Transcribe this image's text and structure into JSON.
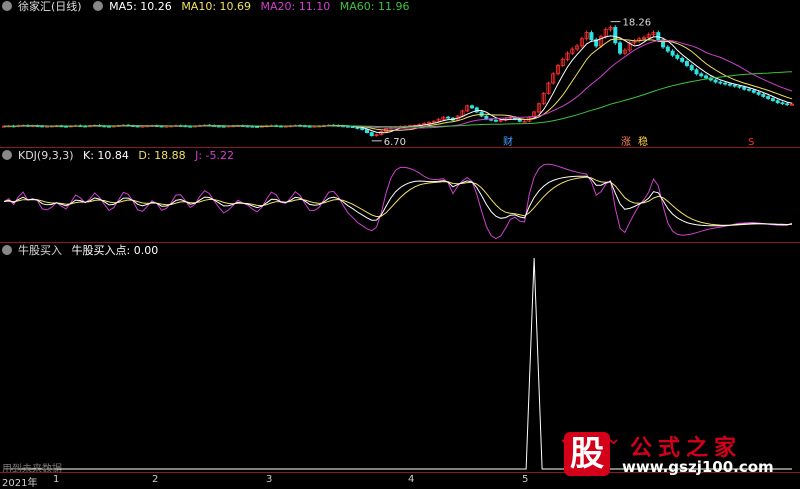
{
  "main_legend": {
    "title": "徐家汇(日线)",
    "ma": [
      {
        "text": "MA5: 10.26",
        "color": "#ffffff"
      },
      {
        "text": "MA10: 10.69",
        "color": "#f0e060"
      },
      {
        "text": "MA20: 11.10",
        "color": "#d040d0"
      },
      {
        "text": "MA60: 11.96",
        "color": "#40c040"
      }
    ]
  },
  "kdj_legend": {
    "name": "KDJ(9,3,3)",
    "k": "K: 10.84",
    "d": "D: 18.88",
    "j": "J: -5.22",
    "colors": {
      "k": "#ffffff",
      "d": "#f0e060",
      "j": "#d040d0"
    }
  },
  "buy_legend": {
    "name": "牛股买入",
    "value": "牛股买入点: 0.00"
  },
  "annotations": {
    "high": "18.26",
    "low": "6.70",
    "tags": [
      {
        "text": "财",
        "color": "#40a0ff"
      },
      {
        "text": "涨",
        "color": "#ff8060"
      },
      {
        "text": "稳",
        "color": "#ffd040"
      },
      {
        "text": "S",
        "color": "#ff3030"
      }
    ]
  },
  "hint": "用到未来数据",
  "time_axis": [
    "2021年",
    "1",
    "2",
    "3",
    "4",
    "5"
  ],
  "logo": {
    "char": "股",
    "name": "公式之家",
    "url": "www.gszj100.com"
  },
  "chart_data": [
    {
      "type": "candlestick",
      "title": "徐家汇(日线)",
      "x_ticks": [
        "2021年",
        "1",
        "2",
        "3",
        "4",
        "5"
      ],
      "price_markers": {
        "high": 18.26,
        "low": 6.7
      },
      "price_range": [
        6.2,
        19.0
      ],
      "ma_last": {
        "MA5": 10.26,
        "MA10": 10.69,
        "MA20": 11.1,
        "MA60": 11.96
      },
      "close": [
        8.12,
        8.15,
        8.1,
        8.18,
        8.2,
        8.13,
        8.17,
        8.15,
        8.1,
        8.12,
        8.14,
        8.16,
        8.12,
        8.1,
        8.15,
        8.18,
        8.14,
        8.12,
        8.16,
        8.2,
        8.15,
        8.12,
        8.1,
        8.14,
        8.18,
        8.22,
        8.18,
        8.14,
        8.1,
        8.12,
        8.16,
        8.18,
        8.14,
        8.1,
        8.12,
        8.15,
        8.18,
        8.16,
        8.12,
        8.1,
        8.14,
        8.18,
        8.22,
        8.18,
        8.14,
        8.12,
        8.1,
        8.14,
        8.16,
        8.18,
        8.14,
        8.12,
        8.1,
        8.08,
        8.12,
        8.16,
        8.18,
        8.14,
        8.1,
        8.12,
        8.16,
        8.2,
        8.16,
        8.12,
        8.1,
        8.12,
        8.14,
        8.18,
        8.22,
        8.2,
        8.16,
        8.12,
        8.08,
        8.05,
        7.9,
        7.8,
        7.5,
        7.2,
        7.3,
        7.6,
        7.9,
        8.0,
        8.05,
        8.1,
        8.12,
        8.18,
        8.2,
        8.3,
        8.4,
        8.5,
        8.6,
        8.8,
        9.0,
        8.9,
        8.7,
        9.1,
        9.6,
        10.1,
        9.9,
        9.5,
        9.1,
        8.8,
        8.7,
        8.6,
        8.7,
        8.9,
        9.0,
        8.8,
        8.6,
        8.6,
        9.0,
        9.5,
        10.3,
        11.3,
        12.3,
        13.2,
        14.0,
        14.6,
        15.2,
        15.6,
        15.9,
        16.6,
        17.2,
        16.5,
        15.9,
        16.8,
        17.5,
        17.7,
        16.2,
        15.2,
        15.5,
        16.2,
        16.4,
        16.6,
        16.7,
        17.0,
        17.2,
        16.5,
        15.8,
        15.4,
        15.0,
        14.7,
        14.4,
        14.0,
        13.6,
        13.2,
        13.0,
        12.8,
        12.6,
        12.4,
        12.3,
        12.2,
        12.1,
        12.0,
        11.9,
        11.7,
        11.6,
        11.4,
        11.2,
        11.0,
        10.8,
        10.6,
        10.4,
        10.3,
        10.2,
        10.26
      ]
    },
    {
      "type": "line",
      "title": "KDJ(9,3,3)",
      "series": [
        {
          "name": "K",
          "last": 10.84
        },
        {
          "name": "D",
          "last": 18.88
        },
        {
          "name": "J",
          "last": -5.22
        }
      ]
    },
    {
      "type": "line",
      "title": "牛股买入",
      "series": [
        {
          "name": "牛股买入点",
          "last": 0.0,
          "spike_value": 1
        }
      ]
    }
  ]
}
